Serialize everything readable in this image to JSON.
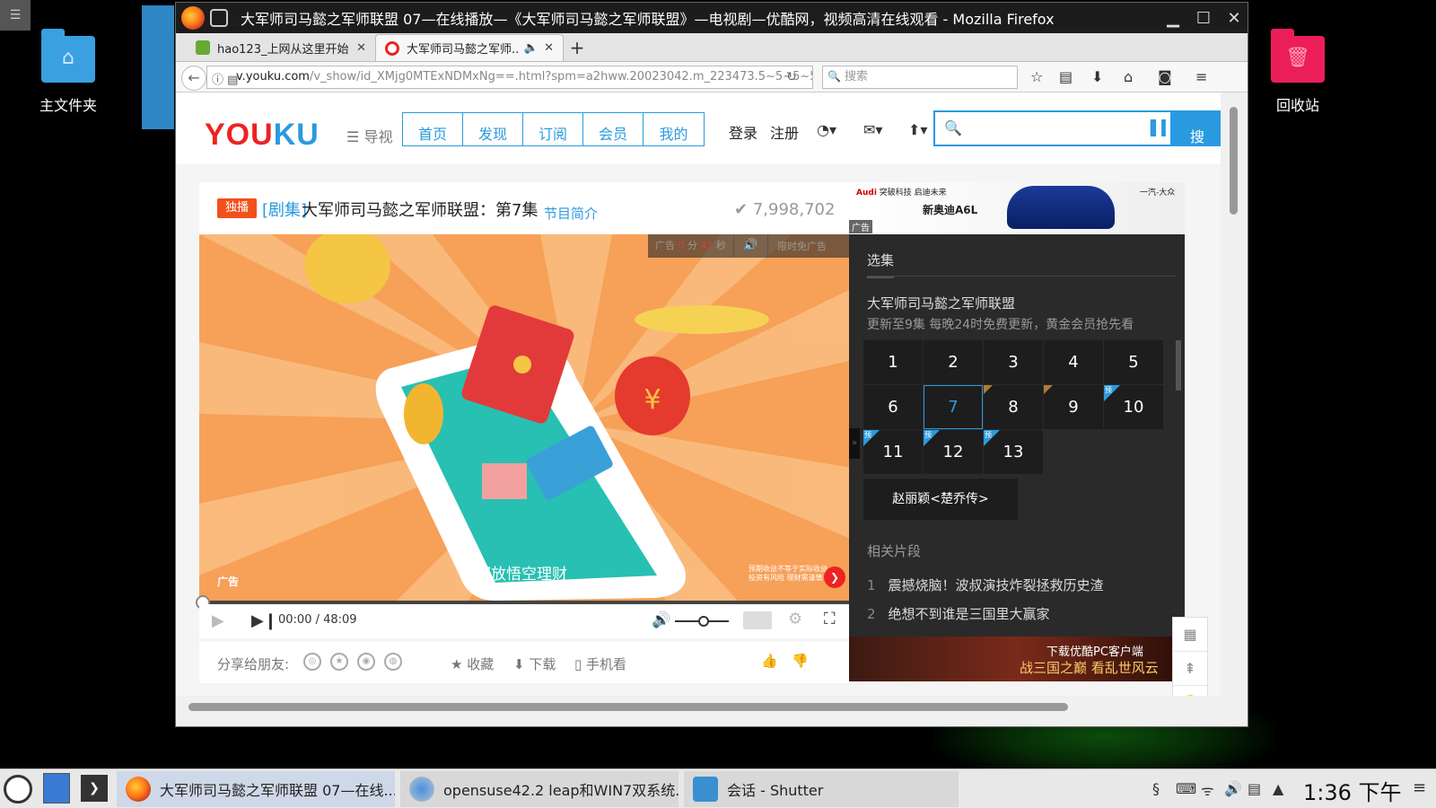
{
  "desktop": {
    "home_label": "主文件夹",
    "trash_label": "回收站"
  },
  "window": {
    "title": "大军师司马懿之军师联盟 07—在线播放—《大军师司马懿之军师联盟》—电视剧—优酷网，视频高清在线观看 - Mozilla Firefox"
  },
  "tabs": [
    {
      "label": "hao123_上网从这里开始"
    },
    {
      "label": "大军师司马懿之军师..."
    }
  ],
  "navbar": {
    "url_host": "v.youku.com",
    "url_path": "/v_show/id_XMjg0MTExNDMxNg==.html?spm=a2hww.20023042.m_223473.5~5~5~5~",
    "search_placeholder": "搜索"
  },
  "youku": {
    "logo_a": "YOU",
    "logo_b": "KU",
    "guide": "导视",
    "nav": [
      "首页",
      "发现",
      "订阅",
      "会员",
      "我的"
    ],
    "login": "登录",
    "register": "注册",
    "search_btn": "搜"
  },
  "episode": {
    "badge": "独播",
    "category": "[剧集]",
    "title": "大军师司马懿之军师联盟：第7集",
    "intro": "节目简介",
    "views": "7,998,702"
  },
  "player": {
    "ad_label_pre": "广告",
    "ad_min": "0",
    "ad_unit_min": "分",
    "ad_sec": "45",
    "ad_unit_sec": "秒",
    "ad_free": "限时免广告",
    "ad_tag": "广告",
    "caption": "都放悟空理财",
    "fine_print": "预期收益不等于实际收益 投资有风险 理财需谨慎",
    "time": "00:00 / 48:09"
  },
  "share": {
    "label": "分享给朋友:",
    "collect": "收藏",
    "download": "下载",
    "mobile": "手机看"
  },
  "banner_ad": {
    "brand_line": "突破科技 启迪未来",
    "brand": "Audi",
    "model": "新奥迪A6L",
    "maker": "一汽-大众",
    "tag": "广告"
  },
  "playlist": {
    "tab": "选集",
    "show_title": "大军师司马懿之军师联盟",
    "update_info": "更新至9集 每晚24时免费更新，黄金会员抢先看",
    "episodes": [
      "1",
      "2",
      "3",
      "4",
      "5",
      "6",
      "7",
      "8",
      "9",
      "10",
      "11",
      "12",
      "13"
    ],
    "current": "7",
    "preview_mark": "预",
    "other_show": "赵丽颖<楚乔传>",
    "related_title": "相关片段",
    "related": [
      {
        "num": "1",
        "title": "震撼烧脑！波叔演技炸裂拯救历史渣"
      },
      {
        "num": "2",
        "title": "绝想不到谁是三国里大赢家"
      }
    ]
  },
  "bottom_ad": {
    "line1": "下载优酷PC客户端",
    "line2": "战三国之巅 看乱世风云"
  },
  "taskbar": {
    "tasks": [
      "大军师司马懿之军师联盟 07—在线...",
      "opensuse42.2 leap和WIN7双系统...",
      "会话 - Shutter"
    ],
    "clock": "1:36 下午"
  }
}
